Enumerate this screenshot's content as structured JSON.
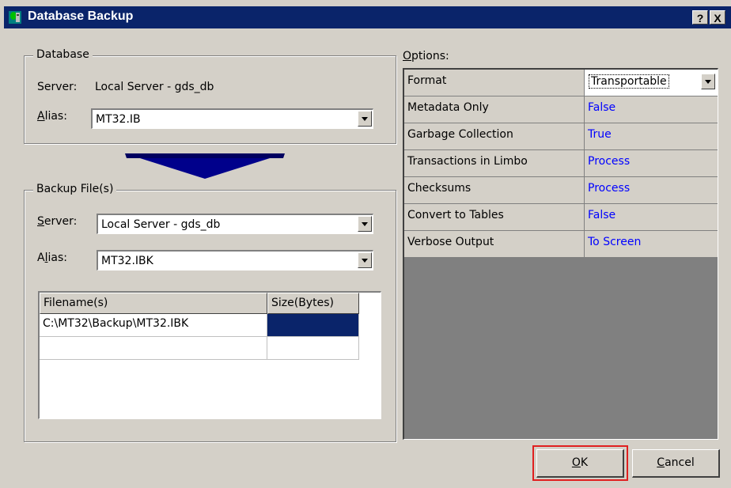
{
  "window": {
    "title": "Database Backup",
    "help_label": "?",
    "close_label": "X"
  },
  "database_group": {
    "label": "Database",
    "server_label": "Server:",
    "server_value": "Local Server - gds_db",
    "alias_label": "Alias:",
    "alias_value": "MT32.IB"
  },
  "backup_group": {
    "label": "Backup File(s)",
    "server_label": "Server:",
    "server_value": "Local Server - gds_db",
    "alias_label": "Alias:",
    "alias_value": "MT32.IBK",
    "columns": [
      "Filename(s)",
      "Size(Bytes)"
    ],
    "rows": [
      {
        "filename": "C:\\MT32\\Backup\\MT32.IBK",
        "size": ""
      }
    ]
  },
  "options": {
    "label": "Options:",
    "format": {
      "name": "Format",
      "value": "Transportable"
    },
    "items": [
      {
        "name": "Metadata Only",
        "value": "False"
      },
      {
        "name": "Garbage Collection",
        "value": "True"
      },
      {
        "name": "Transactions in Limbo",
        "value": "Process"
      },
      {
        "name": "Checksums",
        "value": "Process"
      },
      {
        "name": "Convert to Tables",
        "value": "False"
      },
      {
        "name": "Verbose Output",
        "value": "To Screen"
      }
    ]
  },
  "buttons": {
    "ok": "OK",
    "cancel": "Cancel"
  },
  "colors": {
    "titlebar": "#0a246a",
    "selection": "#0a246a",
    "option_value": "#0000ff",
    "ok_highlight": "#e02020"
  }
}
